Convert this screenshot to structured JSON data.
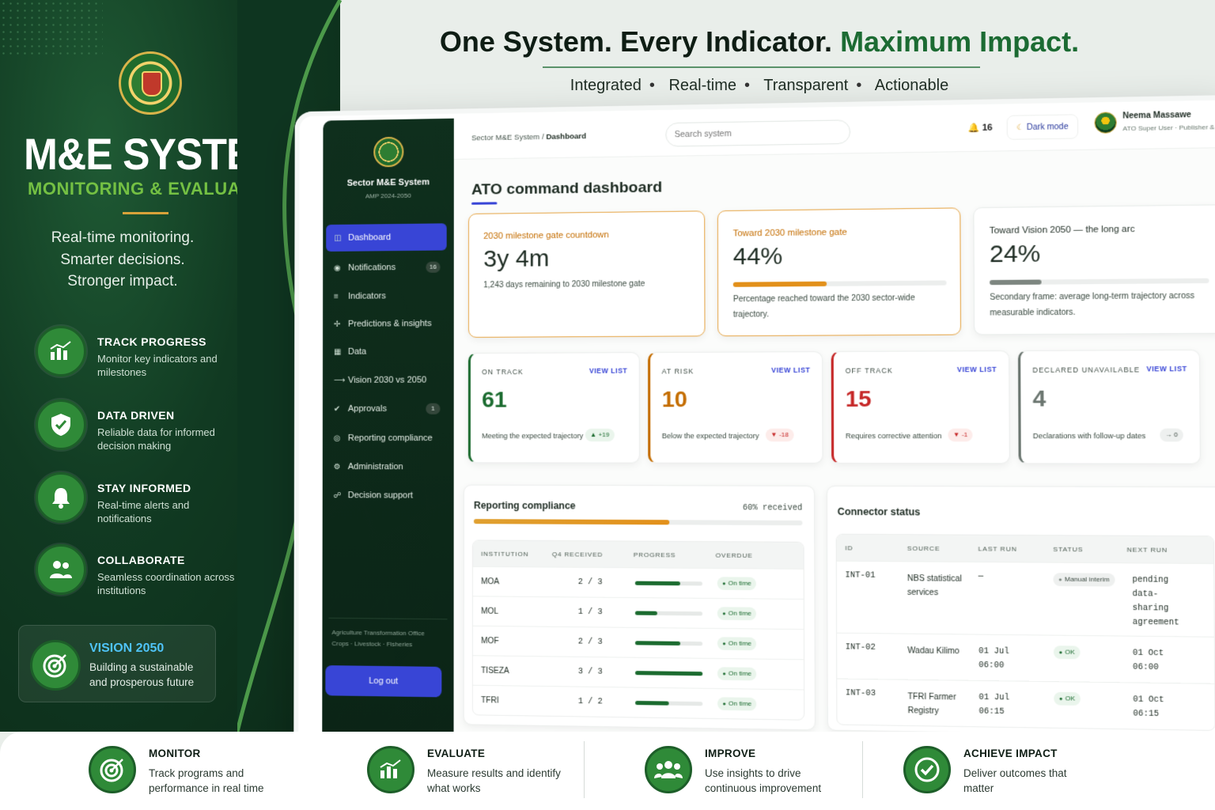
{
  "brand": {
    "title": "M&E SYSTEM",
    "subtitle": "MONITORING & EVALUATION",
    "tagline": [
      "Real-time monitoring.",
      "Smarter decisions.",
      "Stronger impact."
    ]
  },
  "features": [
    {
      "title": "TRACK PROGRESS",
      "desc": "Monitor key indicators and milestones",
      "icon": "bar-chart-icon"
    },
    {
      "title": "DATA DRIVEN",
      "desc": "Reliable data for informed decision making",
      "icon": "shield-check-icon"
    },
    {
      "title": "STAY INFORMED",
      "desc": "Real-time alerts and notifications",
      "icon": "bell-icon"
    },
    {
      "title": "COLLABORATE",
      "desc": "Seamless coordination across institutions",
      "icon": "users-icon"
    }
  ],
  "vision": {
    "title": "VISION 2050",
    "desc": "Building a sustainable and prosperous future",
    "icon": "target-icon"
  },
  "headline": {
    "part1": "One System. Every Indicator. ",
    "part2": "Maximum Impact.",
    "pillars": [
      "Integrated",
      "Real-time",
      "Transparent",
      "Actionable"
    ]
  },
  "sidebar": {
    "system_name": "Sector M&E System",
    "version": "AMP 2024-2050",
    "items": [
      {
        "label": "Dashboard",
        "icon": "◫",
        "badge": ""
      },
      {
        "label": "Notifications",
        "icon": "◉",
        "badge": "16"
      },
      {
        "label": "Indicators",
        "icon": "≡",
        "badge": ""
      },
      {
        "label": "Predictions & insights",
        "icon": "✢",
        "badge": ""
      },
      {
        "label": "Data",
        "icon": "▦",
        "badge": ""
      },
      {
        "label": "Vision 2030 vs 2050",
        "icon": "⟶",
        "badge": ""
      },
      {
        "label": "Approvals",
        "icon": "✔",
        "badge": "1"
      },
      {
        "label": "Reporting compliance",
        "icon": "◎",
        "badge": ""
      },
      {
        "label": "Administration",
        "icon": "⚙",
        "badge": ""
      },
      {
        "label": "Decision support",
        "icon": "☍",
        "badge": ""
      }
    ],
    "org_line1": "Agriculture Transformation Office",
    "org_line2": "Crops · Livestock · Fisheries",
    "logout": "Log out"
  },
  "topbar": {
    "breadcrumb_root": "Sector M&E System",
    "breadcrumb_sep": "/",
    "breadcrumb_current": "Dashboard",
    "search_placeholder": "Search system",
    "notif_count": "16",
    "dark_mode": "Dark mode",
    "user_name": "Neema Massawe",
    "user_role": "ATO Super User · Publisher & Admin"
  },
  "dashboard": {
    "title": "ATO command dashboard",
    "hero": [
      {
        "label": "2030 milestone gate countdown",
        "value": "3y 4m",
        "sub": "1,243 days remaining to 2030 milestone gate"
      },
      {
        "label": "Toward 2030 milestone gate",
        "value": "44%",
        "progress": 0.44,
        "sub": "Percentage reached toward the 2030 sector-wide trajectory."
      },
      {
        "label": "Toward Vision 2050 — the long arc",
        "value": "24%",
        "progress": 0.24,
        "sub": "Secondary frame: average long-term trajectory across measurable indicators."
      }
    ],
    "stats": [
      {
        "label": "ON TRACK",
        "value": "61",
        "desc": "Meeting the expected trajectory",
        "delta": "▲ +19",
        "color": "#1b6b2f",
        "view": "VIEW LIST"
      },
      {
        "label": "AT RISK",
        "value": "10",
        "desc": "Below the expected trajectory",
        "delta": "▼ -18",
        "color": "#c46d00",
        "view": "VIEW LIST"
      },
      {
        "label": "OFF TRACK",
        "value": "15",
        "desc": "Requires corrective attention",
        "delta": "▼ -1",
        "color": "#c62828",
        "view": "VIEW LIST"
      },
      {
        "label": "DECLARED UNAVAILABLE",
        "value": "4",
        "desc": "Declarations with follow-up dates",
        "delta": "→ 0",
        "color": "#6b7670",
        "view": "VIEW LIST"
      }
    ],
    "compliance": {
      "title": "Reporting compliance",
      "pct_label": "60% received",
      "progress": 0.6,
      "columns": [
        "INSTITUTION",
        "Q4 RECEIVED",
        "PROGRESS",
        "OVERDUE"
      ],
      "rows": [
        {
          "inst": "MOA",
          "received": "2 / 3",
          "progress": 0.67,
          "status": "On time"
        },
        {
          "inst": "MOL",
          "received": "1 / 3",
          "progress": 0.33,
          "status": "On time"
        },
        {
          "inst": "MOF",
          "received": "2 / 3",
          "progress": 0.67,
          "status": "On time"
        },
        {
          "inst": "TISEZA",
          "received": "3 / 3",
          "progress": 1.0,
          "status": "On time"
        },
        {
          "inst": "TFRI",
          "received": "1 / 2",
          "progress": 0.5,
          "status": "On time"
        }
      ]
    },
    "connectors": {
      "title": "Connector status",
      "columns": [
        "ID",
        "SOURCE",
        "LAST RUN",
        "STATUS",
        "NEXT RUN"
      ],
      "rows": [
        {
          "id": "INT-01",
          "source": "NBS statistical services",
          "last": "—",
          "status": "Manual interim",
          "next": "pending data-sharing agreement"
        },
        {
          "id": "INT-02",
          "source": "Wadau Kilimo",
          "last": "01 Jul 06:00",
          "status": "OK",
          "next": "01 Oct 06:00"
        },
        {
          "id": "INT-03",
          "source": "TFRI Farmer Registry",
          "last": "01 Jul 06:15",
          "status": "OK",
          "next": "01 Oct 06:15"
        }
      ]
    }
  },
  "bottom": [
    {
      "title": "MONITOR",
      "desc": "Track programs and performance in real time",
      "icon": "target-icon"
    },
    {
      "title": "EVALUATE",
      "desc": "Measure results and identify what works",
      "icon": "bar-chart-icon"
    },
    {
      "title": "IMPROVE",
      "desc": "Use insights to drive continuous improvement",
      "icon": "users-icon"
    },
    {
      "title": "ACHIEVE IMPACT",
      "desc": "Deliver outcomes that matter",
      "icon": "check-circle-icon"
    }
  ]
}
